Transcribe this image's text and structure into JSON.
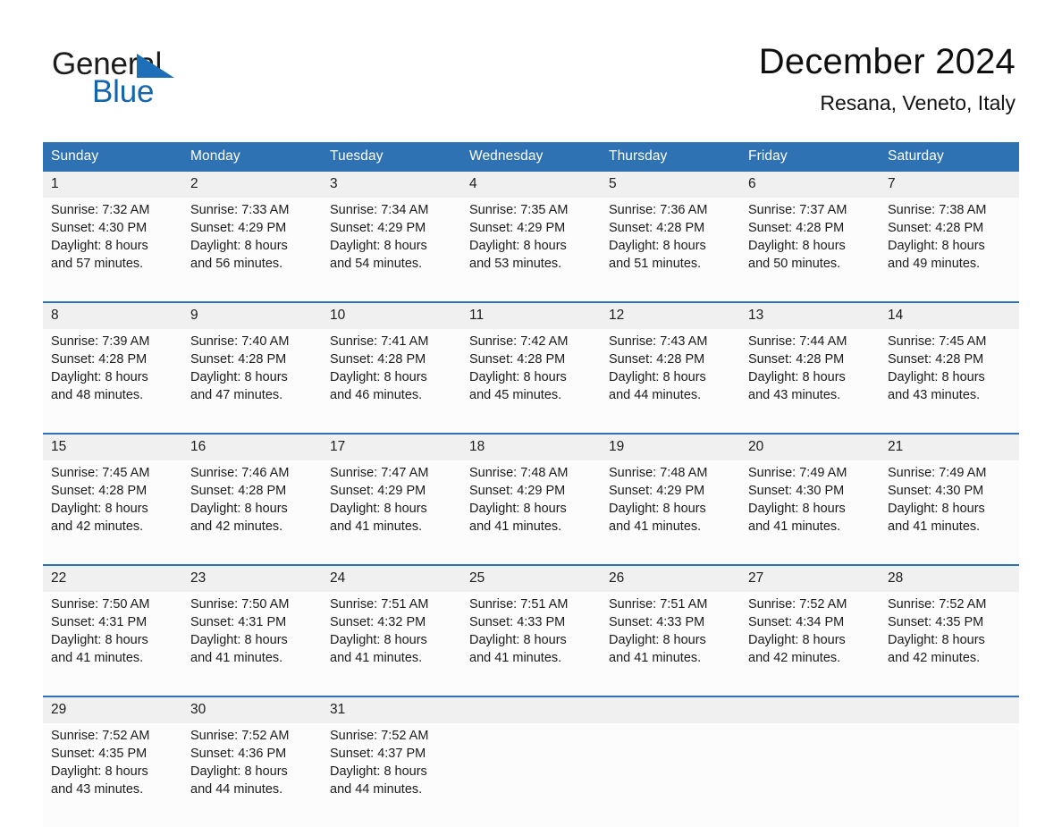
{
  "logo": {
    "word1": "General",
    "word2": "Blue",
    "triangle_color": "#1d70b7",
    "word2_color": "#1366ad"
  },
  "header": {
    "title": "December 2024",
    "location": "Resana, Veneto, Italy"
  },
  "colors": {
    "header_blue": "#2f72b3",
    "daynum_band": "#f0f0f0",
    "cell_background": "#fcfcfc"
  },
  "calendar": {
    "weekday_headers": [
      "Sunday",
      "Monday",
      "Tuesday",
      "Wednesday",
      "Thursday",
      "Friday",
      "Saturday"
    ],
    "weeks": [
      [
        {
          "day": "1",
          "sunrise": "Sunrise: 7:32 AM",
          "sunset": "Sunset: 4:30 PM",
          "daylight1": "Daylight: 8 hours",
          "daylight2": "and 57 minutes."
        },
        {
          "day": "2",
          "sunrise": "Sunrise: 7:33 AM",
          "sunset": "Sunset: 4:29 PM",
          "daylight1": "Daylight: 8 hours",
          "daylight2": "and 56 minutes."
        },
        {
          "day": "3",
          "sunrise": "Sunrise: 7:34 AM",
          "sunset": "Sunset: 4:29 PM",
          "daylight1": "Daylight: 8 hours",
          "daylight2": "and 54 minutes."
        },
        {
          "day": "4",
          "sunrise": "Sunrise: 7:35 AM",
          "sunset": "Sunset: 4:29 PM",
          "daylight1": "Daylight: 8 hours",
          "daylight2": "and 53 minutes."
        },
        {
          "day": "5",
          "sunrise": "Sunrise: 7:36 AM",
          "sunset": "Sunset: 4:28 PM",
          "daylight1": "Daylight: 8 hours",
          "daylight2": "and 51 minutes."
        },
        {
          "day": "6",
          "sunrise": "Sunrise: 7:37 AM",
          "sunset": "Sunset: 4:28 PM",
          "daylight1": "Daylight: 8 hours",
          "daylight2": "and 50 minutes."
        },
        {
          "day": "7",
          "sunrise": "Sunrise: 7:38 AM",
          "sunset": "Sunset: 4:28 PM",
          "daylight1": "Daylight: 8 hours",
          "daylight2": "and 49 minutes."
        }
      ],
      [
        {
          "day": "8",
          "sunrise": "Sunrise: 7:39 AM",
          "sunset": "Sunset: 4:28 PM",
          "daylight1": "Daylight: 8 hours",
          "daylight2": "and 48 minutes."
        },
        {
          "day": "9",
          "sunrise": "Sunrise: 7:40 AM",
          "sunset": "Sunset: 4:28 PM",
          "daylight1": "Daylight: 8 hours",
          "daylight2": "and 47 minutes."
        },
        {
          "day": "10",
          "sunrise": "Sunrise: 7:41 AM",
          "sunset": "Sunset: 4:28 PM",
          "daylight1": "Daylight: 8 hours",
          "daylight2": "and 46 minutes."
        },
        {
          "day": "11",
          "sunrise": "Sunrise: 7:42 AM",
          "sunset": "Sunset: 4:28 PM",
          "daylight1": "Daylight: 8 hours",
          "daylight2": "and 45 minutes."
        },
        {
          "day": "12",
          "sunrise": "Sunrise: 7:43 AM",
          "sunset": "Sunset: 4:28 PM",
          "daylight1": "Daylight: 8 hours",
          "daylight2": "and 44 minutes."
        },
        {
          "day": "13",
          "sunrise": "Sunrise: 7:44 AM",
          "sunset": "Sunset: 4:28 PM",
          "daylight1": "Daylight: 8 hours",
          "daylight2": "and 43 minutes."
        },
        {
          "day": "14",
          "sunrise": "Sunrise: 7:45 AM",
          "sunset": "Sunset: 4:28 PM",
          "daylight1": "Daylight: 8 hours",
          "daylight2": "and 43 minutes."
        }
      ],
      [
        {
          "day": "15",
          "sunrise": "Sunrise: 7:45 AM",
          "sunset": "Sunset: 4:28 PM",
          "daylight1": "Daylight: 8 hours",
          "daylight2": "and 42 minutes."
        },
        {
          "day": "16",
          "sunrise": "Sunrise: 7:46 AM",
          "sunset": "Sunset: 4:28 PM",
          "daylight1": "Daylight: 8 hours",
          "daylight2": "and 42 minutes."
        },
        {
          "day": "17",
          "sunrise": "Sunrise: 7:47 AM",
          "sunset": "Sunset: 4:29 PM",
          "daylight1": "Daylight: 8 hours",
          "daylight2": "and 41 minutes."
        },
        {
          "day": "18",
          "sunrise": "Sunrise: 7:48 AM",
          "sunset": "Sunset: 4:29 PM",
          "daylight1": "Daylight: 8 hours",
          "daylight2": "and 41 minutes."
        },
        {
          "day": "19",
          "sunrise": "Sunrise: 7:48 AM",
          "sunset": "Sunset: 4:29 PM",
          "daylight1": "Daylight: 8 hours",
          "daylight2": "and 41 minutes."
        },
        {
          "day": "20",
          "sunrise": "Sunrise: 7:49 AM",
          "sunset": "Sunset: 4:30 PM",
          "daylight1": "Daylight: 8 hours",
          "daylight2": "and 41 minutes."
        },
        {
          "day": "21",
          "sunrise": "Sunrise: 7:49 AM",
          "sunset": "Sunset: 4:30 PM",
          "daylight1": "Daylight: 8 hours",
          "daylight2": "and 41 minutes."
        }
      ],
      [
        {
          "day": "22",
          "sunrise": "Sunrise: 7:50 AM",
          "sunset": "Sunset: 4:31 PM",
          "daylight1": "Daylight: 8 hours",
          "daylight2": "and 41 minutes."
        },
        {
          "day": "23",
          "sunrise": "Sunrise: 7:50 AM",
          "sunset": "Sunset: 4:31 PM",
          "daylight1": "Daylight: 8 hours",
          "daylight2": "and 41 minutes."
        },
        {
          "day": "24",
          "sunrise": "Sunrise: 7:51 AM",
          "sunset": "Sunset: 4:32 PM",
          "daylight1": "Daylight: 8 hours",
          "daylight2": "and 41 minutes."
        },
        {
          "day": "25",
          "sunrise": "Sunrise: 7:51 AM",
          "sunset": "Sunset: 4:33 PM",
          "daylight1": "Daylight: 8 hours",
          "daylight2": "and 41 minutes."
        },
        {
          "day": "26",
          "sunrise": "Sunrise: 7:51 AM",
          "sunset": "Sunset: 4:33 PM",
          "daylight1": "Daylight: 8 hours",
          "daylight2": "and 41 minutes."
        },
        {
          "day": "27",
          "sunrise": "Sunrise: 7:52 AM",
          "sunset": "Sunset: 4:34 PM",
          "daylight1": "Daylight: 8 hours",
          "daylight2": "and 42 minutes."
        },
        {
          "day": "28",
          "sunrise": "Sunrise: 7:52 AM",
          "sunset": "Sunset: 4:35 PM",
          "daylight1": "Daylight: 8 hours",
          "daylight2": "and 42 minutes."
        }
      ],
      [
        {
          "day": "29",
          "sunrise": "Sunrise: 7:52 AM",
          "sunset": "Sunset: 4:35 PM",
          "daylight1": "Daylight: 8 hours",
          "daylight2": "and 43 minutes."
        },
        {
          "day": "30",
          "sunrise": "Sunrise: 7:52 AM",
          "sunset": "Sunset: 4:36 PM",
          "daylight1": "Daylight: 8 hours",
          "daylight2": "and 44 minutes."
        },
        {
          "day": "31",
          "sunrise": "Sunrise: 7:52 AM",
          "sunset": "Sunset: 4:37 PM",
          "daylight1": "Daylight: 8 hours",
          "daylight2": "and 44 minutes."
        },
        {
          "day": "",
          "sunrise": "",
          "sunset": "",
          "daylight1": "",
          "daylight2": ""
        },
        {
          "day": "",
          "sunrise": "",
          "sunset": "",
          "daylight1": "",
          "daylight2": ""
        },
        {
          "day": "",
          "sunrise": "",
          "sunset": "",
          "daylight1": "",
          "daylight2": ""
        },
        {
          "day": "",
          "sunrise": "",
          "sunset": "",
          "daylight1": "",
          "daylight2": ""
        }
      ]
    ]
  }
}
